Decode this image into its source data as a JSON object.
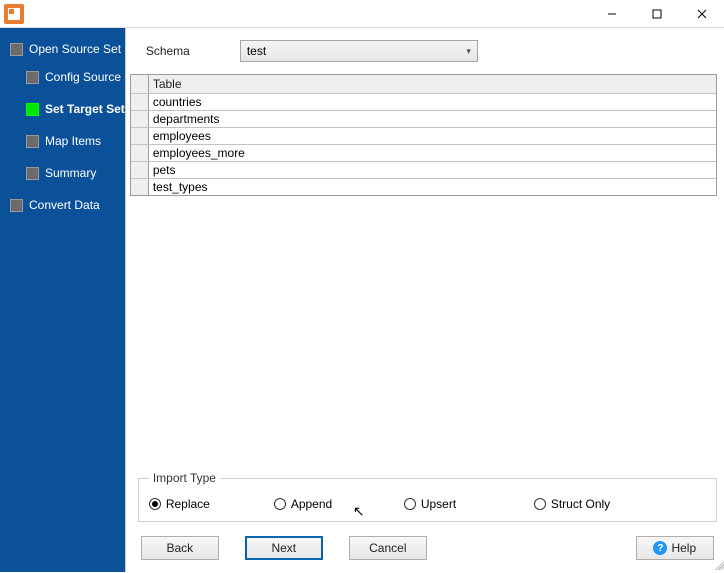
{
  "sidebar": {
    "items": [
      {
        "label": "Open Source Set",
        "level": 1,
        "active": false
      },
      {
        "label": "Config Source",
        "level": 2,
        "active": false
      },
      {
        "label": "Set Target Set",
        "level": 2,
        "active": true
      },
      {
        "label": "Map Items",
        "level": 2,
        "active": false
      },
      {
        "label": "Summary",
        "level": 2,
        "active": false
      },
      {
        "label": "Convert Data",
        "level": 1,
        "active": false
      }
    ]
  },
  "schema": {
    "label": "Schema",
    "value": "test"
  },
  "table": {
    "header": "Table",
    "rows": [
      "countries",
      "departments",
      "employees",
      "employees_more",
      "pets",
      "test_types"
    ]
  },
  "import_type": {
    "legend": "Import Type",
    "options": [
      {
        "label": "Replace",
        "selected": true
      },
      {
        "label": "Append",
        "selected": false
      },
      {
        "label": "Upsert",
        "selected": false
      },
      {
        "label": "Struct Only",
        "selected": false
      }
    ]
  },
  "buttons": {
    "back": "Back",
    "next": "Next",
    "cancel": "Cancel",
    "help": "Help"
  }
}
